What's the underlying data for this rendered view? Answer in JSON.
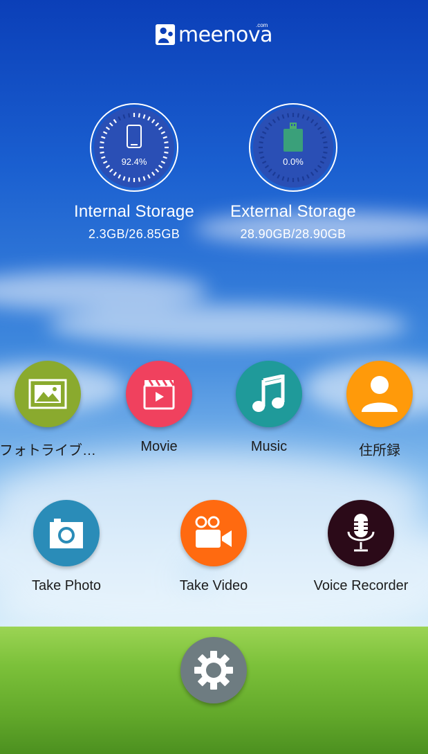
{
  "logo": {
    "text": "meenova",
    "com": ".com"
  },
  "storage": [
    {
      "name": "Internal Storage",
      "size": "2.3GB/26.85GB",
      "percent_label": "92.4%",
      "percent": 92.4,
      "icon": "phone-icon"
    },
    {
      "name": "External Storage",
      "size": "28.90GB/28.90GB",
      "percent_label": "0.0%",
      "percent": 0.0,
      "icon": "usb-drive-icon"
    }
  ],
  "apps_row1": [
    {
      "label": "フォトライブ…",
      "color": "#8aaa2e",
      "icon": "photo-library-icon"
    },
    {
      "label": "Movie",
      "color": "#f0415e",
      "icon": "movie-clapper-icon"
    },
    {
      "label": "Music",
      "color": "#1f9a9a",
      "icon": "music-note-icon"
    },
    {
      "label": "住所録",
      "color": "#ff9a0a",
      "icon": "contact-person-icon"
    }
  ],
  "apps_row2": [
    {
      "label": "Take Photo",
      "color": "#2a8cb8",
      "icon": "camera-icon"
    },
    {
      "label": "Take Video",
      "color": "#ff6a10",
      "icon": "video-camera-icon"
    },
    {
      "label": "Voice Recorder",
      "color": "#2b0a18",
      "icon": "microphone-icon"
    }
  ],
  "settings": {
    "icon": "gear-icon",
    "color": "#6e7c81"
  }
}
